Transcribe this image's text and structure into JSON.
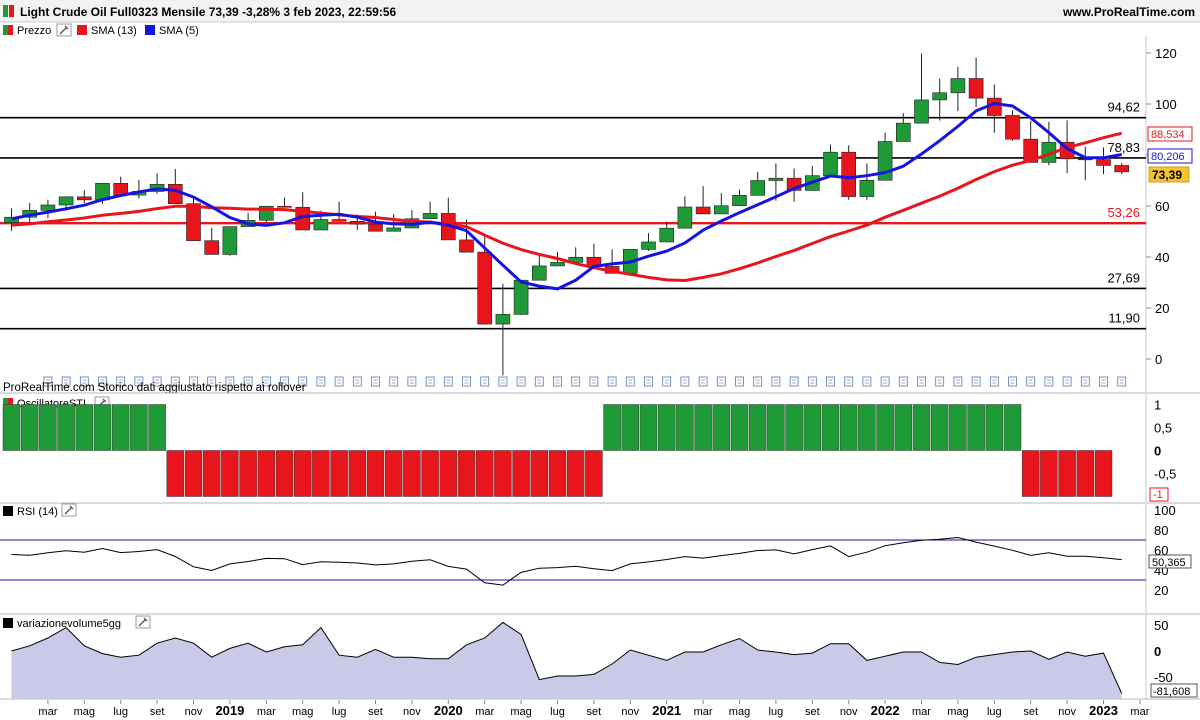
{
  "header": {
    "title": "Light Crude Oil Full0323 Mensile 73,39 -3,28% 3 feb 2023, 22:59:56",
    "site": "www.ProRealTime.com"
  },
  "legend": {
    "price": "Prezzo",
    "sma13": "SMA (13)",
    "sma5": "SMA (5)"
  },
  "watermark": "ProRealTime.com  Storico dati aggiustato rispetto ai rollover",
  "panels": {
    "oscillator_label": "OscillatoreSTI",
    "rsi_label": "RSI (14)",
    "volume_label": "variazionevolume5gg"
  },
  "colors": {
    "up": "#1e9a37",
    "down": "#e8161c",
    "sma13": "#e8161c",
    "sma5": "#1414e0",
    "rsi_line": "#000000",
    "band": "#1414b0",
    "volume_fill": "#c9c9e8"
  },
  "badges": {
    "sma13": "88,534",
    "sma5": "80,206",
    "last": "73,39",
    "rsi": "50,365",
    "volume": "-81,608"
  },
  "chart_data": {
    "type": "candlestick",
    "x": [
      "2018-01",
      "2018-02",
      "2018-03",
      "2018-04",
      "2018-05",
      "2018-06",
      "2018-07",
      "2018-08",
      "2018-09",
      "2018-10",
      "2018-11",
      "2018-12",
      "2019-01",
      "2019-02",
      "2019-03",
      "2019-04",
      "2019-05",
      "2019-06",
      "2019-07",
      "2019-08",
      "2019-09",
      "2019-10",
      "2019-11",
      "2019-12",
      "2020-01",
      "2020-02",
      "2020-03",
      "2020-04",
      "2020-05",
      "2020-06",
      "2020-07",
      "2020-08",
      "2020-09",
      "2020-10",
      "2020-11",
      "2020-12",
      "2021-01",
      "2021-02",
      "2021-03",
      "2021-04",
      "2021-05",
      "2021-06",
      "2021-07",
      "2021-08",
      "2021-09",
      "2021-10",
      "2021-11",
      "2021-12",
      "2022-01",
      "2022-02",
      "2022-03",
      "2022-04",
      "2022-05",
      "2022-06",
      "2022-07",
      "2022-08",
      "2022-09",
      "2022-10",
      "2022-11",
      "2022-12",
      "2023-01",
      "2023-02"
    ],
    "open": [
      53.5,
      55.6,
      58.3,
      60.4,
      63.6,
      62.4,
      68.9,
      64.3,
      65.7,
      68.5,
      60.9,
      46.4,
      41.0,
      51.9,
      54.4,
      59.9,
      59.5,
      50.6,
      54.7,
      54.0,
      52.9,
      50.1,
      51.4,
      55.0,
      57.1,
      46.7,
      41.9,
      13.7,
      17.5,
      30.9,
      36.5,
      37.9,
      39.9,
      36.3,
      33.6,
      43.0,
      45.9,
      51.3,
      59.6,
      56.9,
      60.1,
      64.2,
      70.0,
      70.9,
      66.1,
      71.9,
      81.1,
      63.7,
      70.1,
      85.3,
      92.5,
      101.6,
      104.4,
      110.0,
      102.3,
      95.5,
      86.2,
      77.1,
      85.0,
      78.5,
      78.2,
      75.9
    ],
    "high": [
      59.0,
      61.2,
      62.5,
      63.8,
      66.2,
      68.4,
      71.5,
      70.2,
      72.8,
      74.5,
      63.1,
      51.4,
      49.0,
      57.3,
      59.8,
      63.3,
      65.4,
      58.1,
      61.7,
      56.7,
      57.8,
      56.8,
      58.4,
      61.7,
      63.3,
      54.7,
      48.8,
      29.5,
      30.0,
      40.7,
      41.9,
      43.8,
      45.2,
      43.0,
      42.4,
      49.3,
      53.9,
      63.8,
      67.8,
      65.0,
      66.4,
      73.4,
      76.7,
      74.7,
      75.7,
      84.0,
      83.8,
      76.7,
      88.8,
      96.4,
      119.8,
      110.0,
      114.6,
      118.2,
      107.7,
      97.5,
      93.4,
      93.0,
      93.6,
      83.3,
      83.0,
      77.0
    ],
    "low": [
      50.3,
      53.4,
      55.2,
      58.1,
      61.2,
      60.9,
      65.2,
      62.9,
      64.8,
      64.8,
      49.4,
      42.4,
      40.5,
      51.8,
      53.4,
      59.9,
      50.6,
      50.6,
      54.0,
      50.5,
      52.1,
      50.0,
      51.2,
      55.0,
      50.7,
      44.0,
      20.0,
      -6.4,
      17.3,
      30.8,
      36.5,
      37.9,
      36.1,
      33.6,
      33.6,
      42.4,
      46.2,
      51.3,
      57.3,
      56.9,
      60.1,
      64.2,
      62.1,
      61.7,
      66.1,
      71.9,
      62.4,
      62.4,
      70.1,
      85.3,
      92.5,
      93.5,
      97.2,
      98.8,
      88.7,
      85.6,
      81.1,
      76.0,
      72.9,
      70.1,
      72.5,
      72.5
    ],
    "close": [
      55.6,
      58.3,
      60.4,
      63.6,
      62.4,
      68.9,
      64.3,
      65.7,
      68.5,
      60.9,
      46.4,
      41.0,
      51.9,
      54.4,
      59.9,
      59.5,
      50.6,
      54.7,
      54.0,
      52.9,
      50.1,
      51.4,
      55.0,
      57.1,
      46.7,
      41.9,
      13.7,
      17.5,
      30.9,
      36.5,
      37.9,
      39.9,
      36.3,
      33.6,
      43.0,
      45.9,
      51.3,
      59.6,
      56.9,
      60.1,
      64.2,
      70.0,
      70.9,
      66.1,
      71.9,
      81.1,
      63.7,
      70.1,
      85.3,
      92.5,
      101.6,
      104.4,
      110.0,
      102.3,
      95.5,
      86.2,
      77.1,
      85.0,
      78.5,
      78.2,
      75.9,
      73.39
    ],
    "sma13": [
      52.5,
      53.0,
      53.8,
      54.5,
      55.3,
      56.4,
      57.1,
      57.9,
      59.0,
      59.9,
      59.9,
      59.3,
      59.1,
      58.8,
      58.7,
      58.6,
      57.9,
      57.2,
      56.5,
      55.9,
      55.5,
      54.7,
      54.0,
      53.7,
      52.8,
      51.9,
      48.6,
      45.4,
      42.9,
      41.0,
      39.4,
      37.4,
      35.8,
      34.4,
      33.2,
      32.0,
      31.0,
      30.8,
      32.0,
      33.4,
      35.4,
      37.7,
      40.2,
      42.6,
      45.3,
      48.0,
      50.2,
      52.5,
      55.6,
      58.3,
      61.1,
      63.9,
      67.0,
      70.4,
      73.5,
      76.0,
      77.9,
      80.3,
      82.9,
      84.8,
      86.8,
      88.534
    ],
    "sma5": [
      55.0,
      56.4,
      57.6,
      58.9,
      60.3,
      62.5,
      64.1,
      65.5,
      66.7,
      66.1,
      63.5,
      59.7,
      55.5,
      53.0,
      52.4,
      53.4,
      55.9,
      56.4,
      56.8,
      55.6,
      53.7,
      53.0,
      52.8,
      53.6,
      52.5,
      50.3,
      43.5,
      36.8,
      30.2,
      28.6,
      27.5,
      30.9,
      36.3,
      37.3,
      38.0,
      40.3,
      42.3,
      45.5,
      50.5,
      54.1,
      57.4,
      60.5,
      63.6,
      66.9,
      69.3,
      71.8,
      71.1,
      71.9,
      73.1,
      75.6,
      80.4,
      85.6,
      91.2,
      97.3,
      100.2,
      99.2,
      94.6,
      88.8,
      82.5,
      79.0,
      78.9,
      80.206
    ],
    "hlines": [
      {
        "value": 94.62,
        "label": "94,62",
        "color": "#000000"
      },
      {
        "value": 78.83,
        "label": "78,83",
        "color": "#000000"
      },
      {
        "value": 53.26,
        "label": "53,26",
        "color": "#e8161c"
      },
      {
        "value": 27.69,
        "label": "27,69",
        "color": "#000000"
      },
      {
        "value": 11.9,
        "label": "11,90",
        "color": "#000000"
      }
    ],
    "price_ticks": [
      120,
      100,
      80,
      60,
      40,
      20,
      0
    ],
    "x_ticks": [
      {
        "i": 2,
        "label": "mar",
        "bold": false
      },
      {
        "i": 4,
        "label": "mag",
        "bold": false
      },
      {
        "i": 6,
        "label": "lug",
        "bold": false
      },
      {
        "i": 8,
        "label": "set",
        "bold": false
      },
      {
        "i": 10,
        "label": "nov",
        "bold": false
      },
      {
        "i": 12,
        "label": "2019",
        "bold": true
      },
      {
        "i": 14,
        "label": "mar",
        "bold": false
      },
      {
        "i": 16,
        "label": "mag",
        "bold": false
      },
      {
        "i": 18,
        "label": "lug",
        "bold": false
      },
      {
        "i": 20,
        "label": "set",
        "bold": false
      },
      {
        "i": 22,
        "label": "nov",
        "bold": false
      },
      {
        "i": 24,
        "label": "2020",
        "bold": true
      },
      {
        "i": 26,
        "label": "mar",
        "bold": false
      },
      {
        "i": 28,
        "label": "mag",
        "bold": false
      },
      {
        "i": 30,
        "label": "lug",
        "bold": false
      },
      {
        "i": 32,
        "label": "set",
        "bold": false
      },
      {
        "i": 34,
        "label": "nov",
        "bold": false
      },
      {
        "i": 36,
        "label": "2021",
        "bold": true
      },
      {
        "i": 38,
        "label": "mar",
        "bold": false
      },
      {
        "i": 40,
        "label": "mag",
        "bold": false
      },
      {
        "i": 42,
        "label": "lug",
        "bold": false
      },
      {
        "i": 44,
        "label": "set",
        "bold": false
      },
      {
        "i": 46,
        "label": "nov",
        "bold": false
      },
      {
        "i": 48,
        "label": "2022",
        "bold": true
      },
      {
        "i": 50,
        "label": "mar",
        "bold": false
      },
      {
        "i": 52,
        "label": "mag",
        "bold": false
      },
      {
        "i": 54,
        "label": "lug",
        "bold": false
      },
      {
        "i": 56,
        "label": "set",
        "bold": false
      },
      {
        "i": 58,
        "label": "nov",
        "bold": false
      },
      {
        "i": 60,
        "label": "2023",
        "bold": true
      },
      {
        "i": 62,
        "label": "mar",
        "bold": false
      }
    ],
    "oscillator": {
      "values": [
        1,
        1,
        1,
        1,
        1,
        1,
        1,
        1,
        1,
        -1,
        -1,
        -1,
        -1,
        -1,
        -1,
        -1,
        -1,
        -1,
        -1,
        -1,
        -1,
        -1,
        -1,
        -1,
        -1,
        -1,
        -1,
        -1,
        -1,
        -1,
        -1,
        -1,
        -1,
        1,
        1,
        1,
        1,
        1,
        1,
        1,
        1,
        1,
        1,
        1,
        1,
        1,
        1,
        1,
        1,
        1,
        1,
        1,
        1,
        1,
        1,
        1,
        -1,
        -1,
        -1,
        -1,
        -1
      ],
      "ticks": [
        "1",
        "0,5",
        "0",
        "-0,5"
      ],
      "last_label": "-1"
    },
    "rsi": {
      "values": [
        55.5,
        54.8,
        57.2,
        59.3,
        57.8,
        61.5,
        57.4,
        58.5,
        60.4,
        53.5,
        43.2,
        39.5,
        46.1,
        48.5,
        51.6,
        51.3,
        45.4,
        48.3,
        47.8,
        47.0,
        45.1,
        46.1,
        48.7,
        50.2,
        43.6,
        40.9,
        27.2,
        24.9,
        37.6,
        41.8,
        42.4,
        43.8,
        41.3,
        39.4,
        46.1,
        48.1,
        50.5,
        53.4,
        51.9,
        54.4,
        56.6,
        59.5,
        60.1,
        56.1,
        60.4,
        64.1,
        53.4,
        57.8,
        64.3,
        67.2,
        69.8,
        70.7,
        72.5,
        67.9,
        63.9,
        59.7,
        54.6,
        57.2,
        53.8,
        53.7,
        52.2,
        50.365
      ],
      "ticks": [
        "100",
        "80",
        "60",
        "40",
        "20"
      ],
      "bands": [
        70,
        30
      ]
    },
    "volume": {
      "values": [
        0,
        10,
        25,
        45,
        10,
        -5,
        -12,
        -8,
        15,
        25,
        15,
        -12,
        5,
        15,
        -2,
        8,
        12,
        45,
        -8,
        -12,
        3,
        -12,
        -12,
        -15,
        -15,
        12,
        25,
        55,
        32,
        -55,
        -48,
        -48,
        -45,
        -25,
        2,
        -8,
        -18,
        -2,
        -2,
        12,
        24,
        2,
        -2,
        -7,
        -4,
        14,
        14,
        -18,
        -10,
        -2,
        -2,
        -22,
        -26,
        -12,
        -7,
        -2,
        0,
        -16,
        -2,
        -10,
        -4,
        -81.608
      ],
      "ticks": [
        "50",
        "0",
        "-50"
      ]
    }
  }
}
